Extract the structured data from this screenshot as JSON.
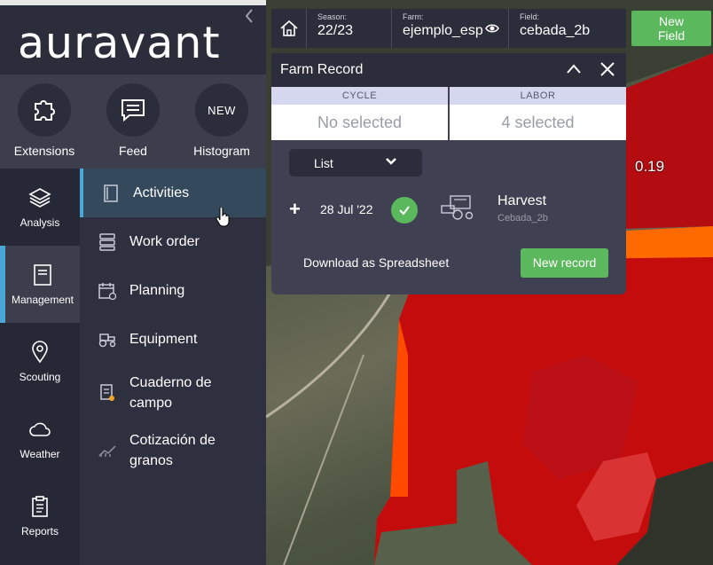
{
  "app": {
    "logo_text": "auravant"
  },
  "quick_actions": [
    {
      "label": "Extensions",
      "icon": "puzzle-icon"
    },
    {
      "label": "Feed",
      "icon": "message-icon"
    },
    {
      "label": "Histogram",
      "badge": "NEW"
    }
  ],
  "left_menu": [
    {
      "label": "Analysis",
      "icon": "layers-icon"
    },
    {
      "label": "Management",
      "icon": "notebook-icon",
      "active": true
    },
    {
      "label": "Scouting",
      "icon": "location-pin-icon"
    },
    {
      "label": "Weather",
      "icon": "cloud-icon"
    },
    {
      "label": "Reports",
      "icon": "clipboard-icon"
    }
  ],
  "right_menu": [
    {
      "label": "Activities",
      "icon": "book-icon",
      "active": true
    },
    {
      "label": "Work order",
      "icon": "stack-icon"
    },
    {
      "label": "Planning",
      "icon": "calendar-icon"
    },
    {
      "label": "Equipment",
      "icon": "tractor-icon"
    },
    {
      "label": "Cuaderno de campo",
      "line1": "Cuaderno de",
      "line2": "campo",
      "icon": "field-notebook-icon"
    },
    {
      "label": "Cotización de granos",
      "line1": "Cotización de",
      "line2": "granos",
      "icon": "chart-trend-icon"
    }
  ],
  "header": {
    "season_label": "Season:",
    "season_value": "22/23",
    "farm_label": "Farm:",
    "farm_value": "ejemplo_esp",
    "field_label": "Field:",
    "field_value": "cebada_2b",
    "new_field_line1": "New",
    "new_field_line2": "Field"
  },
  "panel": {
    "title": "Farm Record",
    "cycle_header": "CYCLE",
    "cycle_value": "No selected",
    "labor_header": "LABOR",
    "labor_value": "4 selected",
    "view_select": "List",
    "record": {
      "date": "28 Jul '22",
      "title": "Harvest",
      "subtitle": "Cebada_2b"
    },
    "download_label": "Download as Spreadsheet",
    "new_record_label": "New record"
  },
  "map": {
    "value_label": "0.19"
  },
  "colors": {
    "accent_blue": "#4aa8d8",
    "green": "#5cb85c",
    "sidebar_dark": "#2b2d3b"
  }
}
